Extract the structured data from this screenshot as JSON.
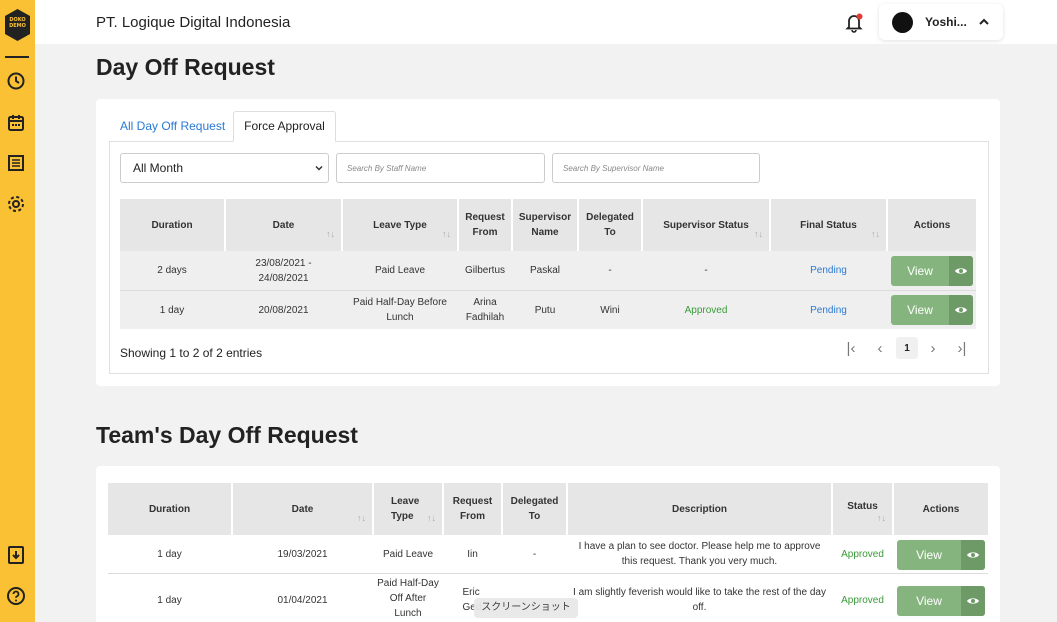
{
  "company": "PT. Logique Digital Indonesia",
  "logo_text": "DOKO\nDEMO",
  "user": {
    "name": "Yoshi..."
  },
  "page_title": "Day Off Request",
  "tabs": [
    "All Day Off Request",
    "Force Approval"
  ],
  "filters": {
    "month": "All Month",
    "staff_placeholder": "Search By Staff Name",
    "supervisor_placeholder": "Search By Supervisor Name"
  },
  "table1": {
    "headers": [
      "Duration",
      "Date",
      "Leave Type",
      "Request From",
      "Supervisor Name",
      "Delegated To",
      "Supervisor Status",
      "Final Status",
      "Actions"
    ],
    "rows": [
      {
        "duration": "2 days",
        "date": "23/08/2021 - 24/08/2021",
        "leave_type": "Paid Leave",
        "request_from": "Gilbertus",
        "supervisor": "Paskal",
        "delegated": "-",
        "supervisor_status": "-",
        "final_status": "Pending",
        "action": "View"
      },
      {
        "duration": "1 day",
        "date": "20/08/2021",
        "leave_type": "Paid Half-Day Before Lunch",
        "request_from": "Arina Fadhilah",
        "supervisor": "Putu",
        "delegated": "Wini",
        "supervisor_status": "Approved",
        "final_status": "Pending",
        "action": "View"
      }
    ]
  },
  "pagination": {
    "entries": "Showing 1 to 2 of 2 entries",
    "current": "1"
  },
  "section2_title": "Team's Day Off Request",
  "table2": {
    "headers": [
      "Duration",
      "Date",
      "Leave Type",
      "Request From",
      "Delegated To",
      "Description",
      "Status",
      "Actions"
    ],
    "rows": [
      {
        "duration": "1 day",
        "date": "19/03/2021",
        "leave_type": "Paid Leave",
        "request_from": "Iin",
        "delegated": "-",
        "description": "I have a plan to see doctor. Please help me to approve this request. Thank you very much.",
        "status": "Approved",
        "action": "View"
      },
      {
        "duration": "1 day",
        "date": "01/04/2021",
        "leave_type": "Paid Half-Day Off After Lunch",
        "request_from": "Eric Ged",
        "delegated": "",
        "description": "I am slightly feverish would like to take the rest of the day off.",
        "status": "Approved",
        "action": "View"
      }
    ]
  },
  "screenshot_label": "スクリーンショット",
  "colors": {
    "sidebar": "#f9c133",
    "accent_blue": "#2a7ad4",
    "approved_green": "#3a9a3a",
    "view_button": "#86b47e"
  },
  "icons": [
    "clock-icon",
    "calendar-icon",
    "list-icon",
    "gear-icon",
    "download-icon",
    "help-icon",
    "bell-icon"
  ]
}
